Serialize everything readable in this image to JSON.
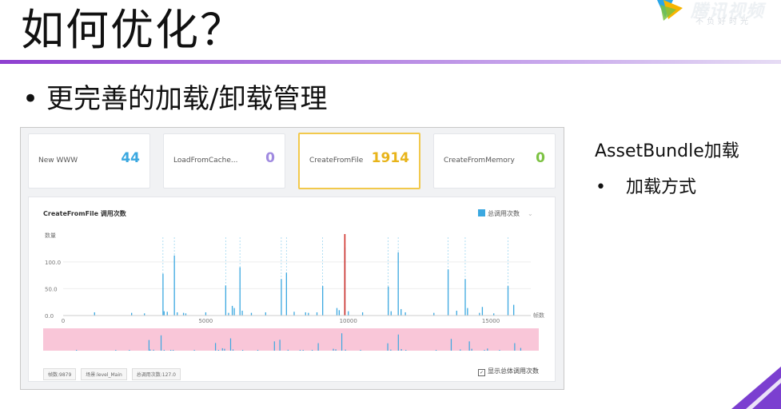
{
  "slide": {
    "title": "如何优化？",
    "bullet": "更完善的加载/卸载管理",
    "bullet_glyph": "•"
  },
  "logo": {
    "word": "腾讯视频",
    "sub": "不负好时光",
    "accent": "#f7b500"
  },
  "cards": [
    {
      "label": "New WWW",
      "value": "44",
      "color": "#3ba8e0",
      "selected": false
    },
    {
      "label": "LoadFromCache...",
      "value": "0",
      "color": "#a08ae0",
      "selected": false
    },
    {
      "label": "CreateFromFile",
      "value": "1914",
      "color": "#e8b41a",
      "selected": true
    },
    {
      "label": "CreateFromMemory",
      "value": "0",
      "color": "#7cc242",
      "selected": false
    }
  ],
  "chart": {
    "title": "CreateFromFile 调用次数",
    "legend": "总调用次数",
    "footer_tags": [
      "帧数:9879",
      "场景:level_Main",
      "总调用次数:127.0"
    ],
    "show_total_label": "显示总体调用次数"
  },
  "chart_data": {
    "type": "bar",
    "ylabel": "数量",
    "xlabel": "帧数",
    "yticks": [
      "100.0",
      "50.0",
      "0.0"
    ],
    "xticks": [
      "0",
      "5000",
      "10000",
      "15000"
    ],
    "ylim": [
      0,
      140
    ],
    "xlim": [
      0,
      16400
    ],
    "selected_frame": 9879,
    "x": [
      1100,
      2400,
      2850,
      3500,
      3540,
      3650,
      3900,
      4000,
      4220,
      4300,
      5000,
      5700,
      5800,
      5930,
      6000,
      6200,
      6280,
      6600,
      7100,
      7650,
      7830,
      8100,
      8500,
      8600,
      8900,
      9100,
      9600,
      9680,
      9879,
      10000,
      10500,
      11400,
      11500,
      11750,
      11850,
      12000,
      13000,
      13500,
      13800,
      14100,
      14180,
      14600,
      14700,
      15100,
      15600,
      15800
    ],
    "values": [
      6,
      5,
      4,
      78,
      8,
      7,
      112,
      6,
      5,
      4,
      6,
      56,
      5,
      18,
      14,
      90,
      9,
      5,
      6,
      68,
      80,
      7,
      6,
      5,
      6,
      55,
      14,
      10,
      127,
      8,
      6,
      54,
      8,
      118,
      12,
      6,
      5,
      86,
      9,
      68,
      14,
      5,
      16,
      4,
      55,
      20
    ]
  },
  "side": {
    "heading": "AssetBundle加载",
    "item": "加载方式",
    "bullet_glyph": "•"
  }
}
